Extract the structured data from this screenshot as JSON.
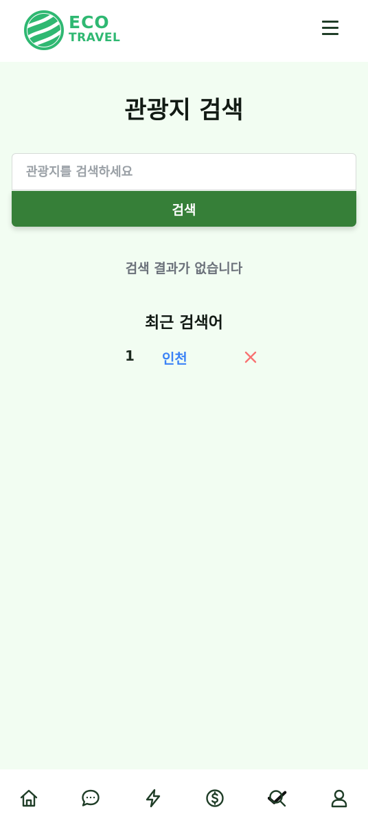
{
  "header": {
    "logo_line1": "ECO",
    "logo_line2": "TRAVEL",
    "menu_icon": "hamburger-menu-icon"
  },
  "page": {
    "title": "관광지 검색"
  },
  "search": {
    "placeholder": "관광지를 검색하세요",
    "value": "",
    "button_label": "검색"
  },
  "results": {
    "empty_message": "검색 결과가 없습니다"
  },
  "recent": {
    "title": "최근 검색어",
    "items": [
      {
        "rank": "1",
        "term": "인천",
        "delete_icon": "close-icon"
      }
    ]
  },
  "bottom_nav": {
    "items": [
      {
        "icon": "home-icon",
        "active": false
      },
      {
        "icon": "chat-icon",
        "active": false
      },
      {
        "icon": "lightning-icon",
        "active": false
      },
      {
        "icon": "dollar-icon",
        "active": false
      },
      {
        "icon": "search-icon",
        "active": true
      },
      {
        "icon": "user-icon",
        "active": false
      }
    ]
  },
  "colors": {
    "brand": "#2fb872",
    "primary_button": "#367f38",
    "page_background": "#f2fdf2",
    "link": "#3b82f6",
    "delete": "#f87171",
    "nav_icon": "#1f3d27"
  }
}
